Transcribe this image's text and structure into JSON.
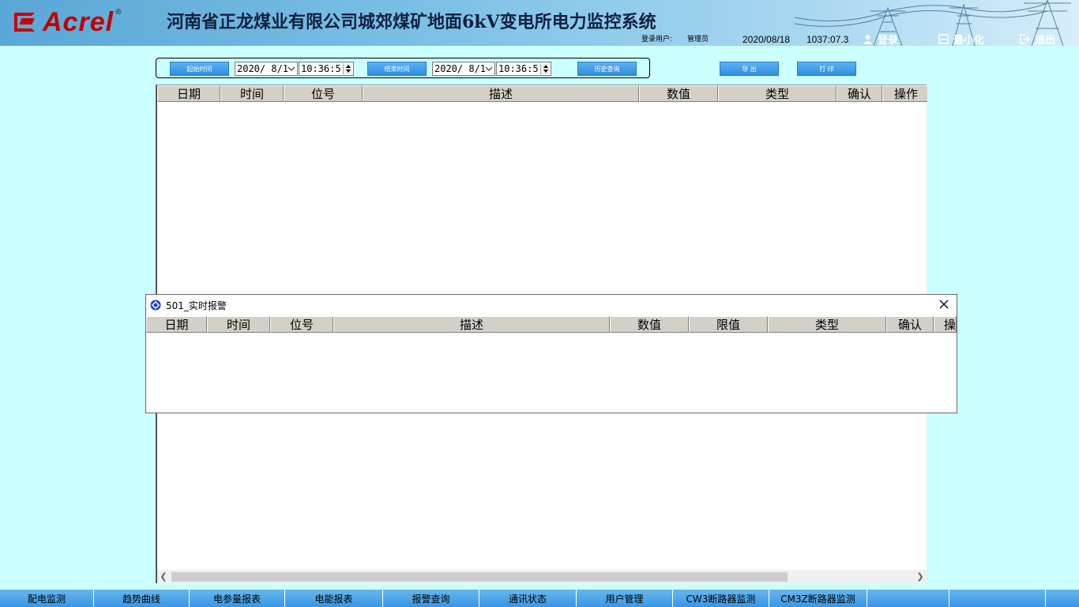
{
  "header": {
    "logo_text": "Acrel",
    "logo_reg": "®",
    "title": "河南省正龙煤业有限公司城郊煤矿地面6kV变电所电力监控系统",
    "login_user_label": "登录用户:",
    "login_user_value": "管理员",
    "date": "2020/08/18",
    "time": "1037:07.3",
    "login_button": "登录",
    "minimize_button": "最小化",
    "exit_button": "退出"
  },
  "query": {
    "start_button": "起始时间",
    "start_date": "2020/ 8/1",
    "start_time": "10:36:5",
    "end_button": "结束时间",
    "end_date": "2020/ 8/1",
    "end_time": "10:36:5",
    "history_button": "历史查询",
    "export_button": "导 出",
    "print_button": "打 印"
  },
  "main_table": {
    "columns": [
      "日期",
      "时间",
      "位号",
      "描述",
      "数值",
      "类型",
      "确认",
      "操作"
    ]
  },
  "alarm_window": {
    "title": "501_实时报警",
    "columns": [
      "日期",
      "时间",
      "位号",
      "描述",
      "数值",
      "限值",
      "类型",
      "确认",
      "操"
    ]
  },
  "bottom_nav": {
    "items": [
      "配电监测",
      "趋势曲线",
      "电参量报表",
      "电能报表",
      "报警查询",
      "通讯状态",
      "用户管理",
      "CW3断路器监测",
      "CM3Z断路器监测",
      "",
      "",
      ""
    ]
  },
  "colors": {
    "background": "#ccffff",
    "header_blue": "#5aa7d6",
    "button_blue": "#2e8de0",
    "logo_red": "#c00000"
  }
}
